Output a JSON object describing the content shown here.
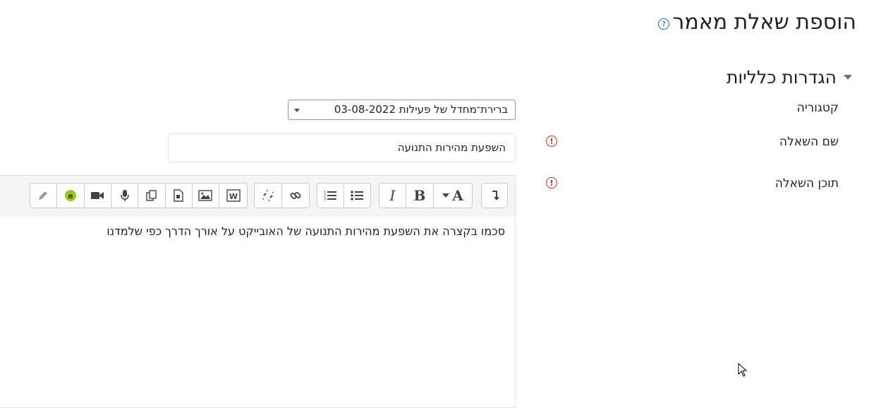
{
  "page": {
    "title": "הוספת שאלת מאמר",
    "help_icon": "question-circle-icon"
  },
  "section": {
    "title": "הגדרות כלליות",
    "icon": "caret-down-icon"
  },
  "fields": {
    "category": {
      "label": "קטגוריה",
      "value": "ברירת־מחדל של פעילות 03-08-2022"
    },
    "question_name": {
      "label": "שם השאלה",
      "value": "השפעת מהירות התנועה",
      "required_icon": "exclamation-circle-icon"
    },
    "question_text": {
      "label": "תוכן השאלה",
      "value": "סכמו בקצרה את השפעת מהירות התנועה של האובייקט על אורך הדרך כפי שלמדנו",
      "required_icon": "exclamation-circle-icon"
    }
  },
  "toolbar": {
    "bold": "B",
    "italic": "I",
    "font": "A",
    "icons": [
      "show-more-icon",
      "font-style-icon",
      "bold-icon",
      "italic-icon",
      "unordered-list-icon",
      "ordered-list-icon",
      "link-icon",
      "unlink-icon",
      "word-import-icon",
      "image-icon",
      "media-icon",
      "manage-files-icon",
      "record-audio-icon",
      "record-video-icon",
      "h5p-icon",
      "pencil-icon"
    ]
  },
  "colors": {
    "accent": "#0f6cbf",
    "required": "#ca3120",
    "h5p": "#9ac51b"
  }
}
